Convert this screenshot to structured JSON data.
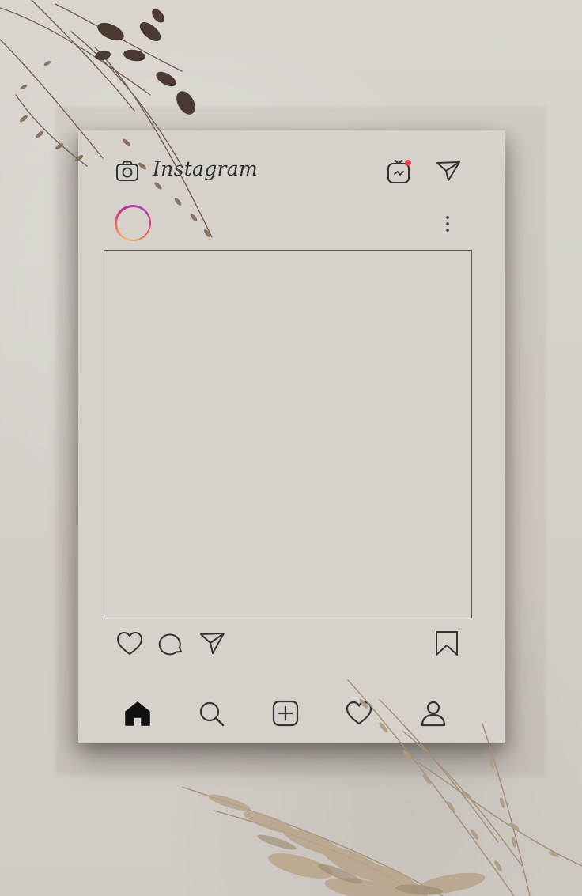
{
  "app": {
    "name": "Instagram"
  },
  "header": {
    "icons": [
      "camera-icon",
      "igtv-icon",
      "paper-plane-icon"
    ],
    "igtv_notification_color": "#e8414a"
  },
  "post": {
    "avatar_ring_colors": [
      "#f7c16b",
      "#ea6e51",
      "#c8358b",
      "#a247b8"
    ],
    "menu_icon": "more-vertical-icon"
  },
  "actions": [
    "heart-icon",
    "comment-icon",
    "paper-plane-icon",
    "bookmark-icon"
  ],
  "bottom_nav": [
    "home-icon",
    "search-icon",
    "add-post-icon",
    "heart-icon",
    "profile-icon"
  ],
  "colors": {
    "background": "#d6d1cb",
    "icon_stroke": "#333333",
    "decor_dark": "#4a3a32",
    "decor_light": "#a58f78"
  }
}
